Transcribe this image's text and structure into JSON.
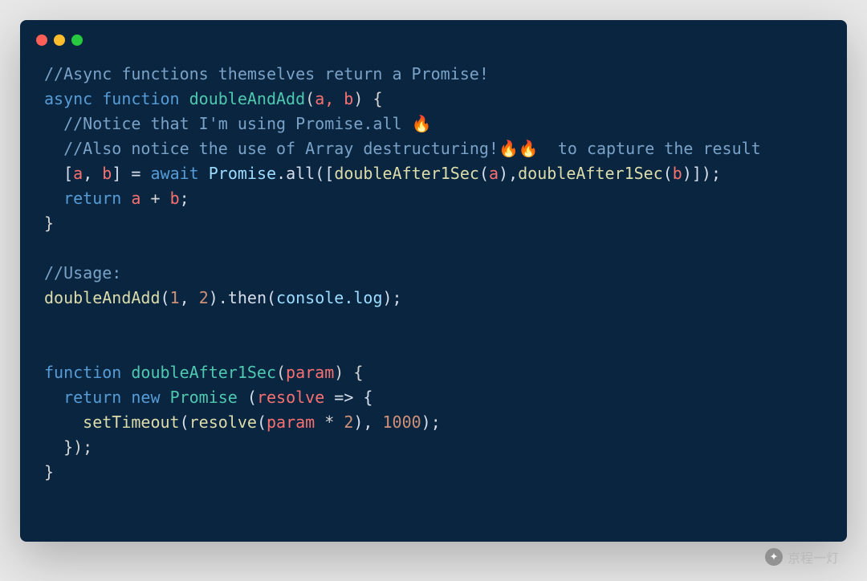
{
  "watermark": "京程一灯",
  "code": {
    "lines": [
      {
        "type": "comment",
        "text": "//Async functions themselves return a Promise!"
      },
      {
        "type": "sig",
        "kw1": "async",
        "kw2": "function",
        "name": "doubleAndAdd",
        "params": "a, b",
        "open": " {"
      },
      {
        "type": "comment_indent",
        "text": "//Notice that I'm using Promise.all 🔥"
      },
      {
        "type": "comment_indent",
        "text": "//Also notice the use of Array destructuring!🔥🔥  to capture the result"
      },
      {
        "type": "await_line",
        "dest": "[a, b]",
        "kw": "await",
        "call1": "Promise.all",
        "inner1": "doubleAfter1Sec",
        "arg1": "a",
        "inner2": "doubleAfter1Sec",
        "arg2": "b"
      },
      {
        "type": "return_ab",
        "kw": "return",
        "expr": "a + b"
      },
      {
        "type": "close",
        "text": "}"
      },
      {
        "type": "blank"
      },
      {
        "type": "comment",
        "text": "//Usage:"
      },
      {
        "type": "usage",
        "fn": "doubleAndAdd",
        "a1": "1",
        "a2": "2",
        "then": ".then",
        "arg": "console.log"
      },
      {
        "type": "blank"
      },
      {
        "type": "blank"
      },
      {
        "type": "sig2",
        "kw": "function",
        "name": "doubleAfter1Sec",
        "params": "param",
        "open": " {"
      },
      {
        "type": "return_new",
        "kw1": "return",
        "kw2": "new",
        "cls": "Promise",
        "arrow_p": "resolve",
        "arrow": " => {"
      },
      {
        "type": "settimeout",
        "fn": "setTimeout",
        "inner": "resolve",
        "p": "param",
        "op": " * ",
        "n1": "2",
        "n2": "1000"
      },
      {
        "type": "close_indent",
        "text": "});"
      },
      {
        "type": "close",
        "text": "}"
      }
    ]
  }
}
